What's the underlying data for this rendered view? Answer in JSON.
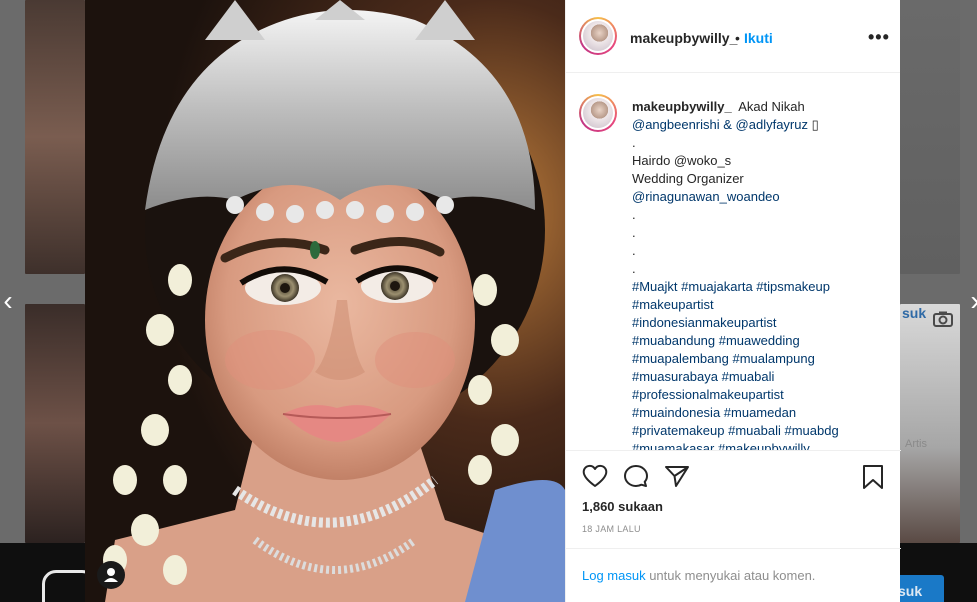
{
  "post": {
    "username": "makeupbywilly_",
    "follow_separator": "•",
    "follow_label": "Ikuti",
    "more_label": "•••",
    "caption": {
      "username": "makeupbywilly_",
      "title": "Akad Nikah",
      "line2": "@angbeenrishi & @adlyfayruz",
      "line2_emoji": "▯",
      "lines": [
        ".",
        "Hairdo @woko_s",
        "Wedding Organizer",
        "@rinagunawan_woandeo",
        ".",
        ".",
        ".",
        ".",
        "#Muajkt #muajakarta #tipsmakeup",
        "#makeupartist",
        "#indonesianmakeupartist",
        "#muabandung #muawedding",
        "#muapalembang #mualampung",
        "#muasurabaya #muabali",
        "#professionalmakeupartist",
        "#muaindonesia #muamedan",
        "#privatemakeup #muabali #muabdg",
        "#muamakasar #makeupbywilly"
      ]
    },
    "likes": "1,860 sukaan",
    "timestamp": "18 JAM LALU",
    "login_link": "Log masuk",
    "login_rest": " untuk menyukai atau komen."
  },
  "background": {
    "login_button": "suk",
    "side_text": "suk",
    "side_text2": "Artis"
  },
  "navigation": {
    "prev": "‹",
    "next": "›"
  },
  "colors": {
    "accent": "#0095f6",
    "link": "#00376b",
    "text": "#262626",
    "muted": "#8e8e8e"
  }
}
